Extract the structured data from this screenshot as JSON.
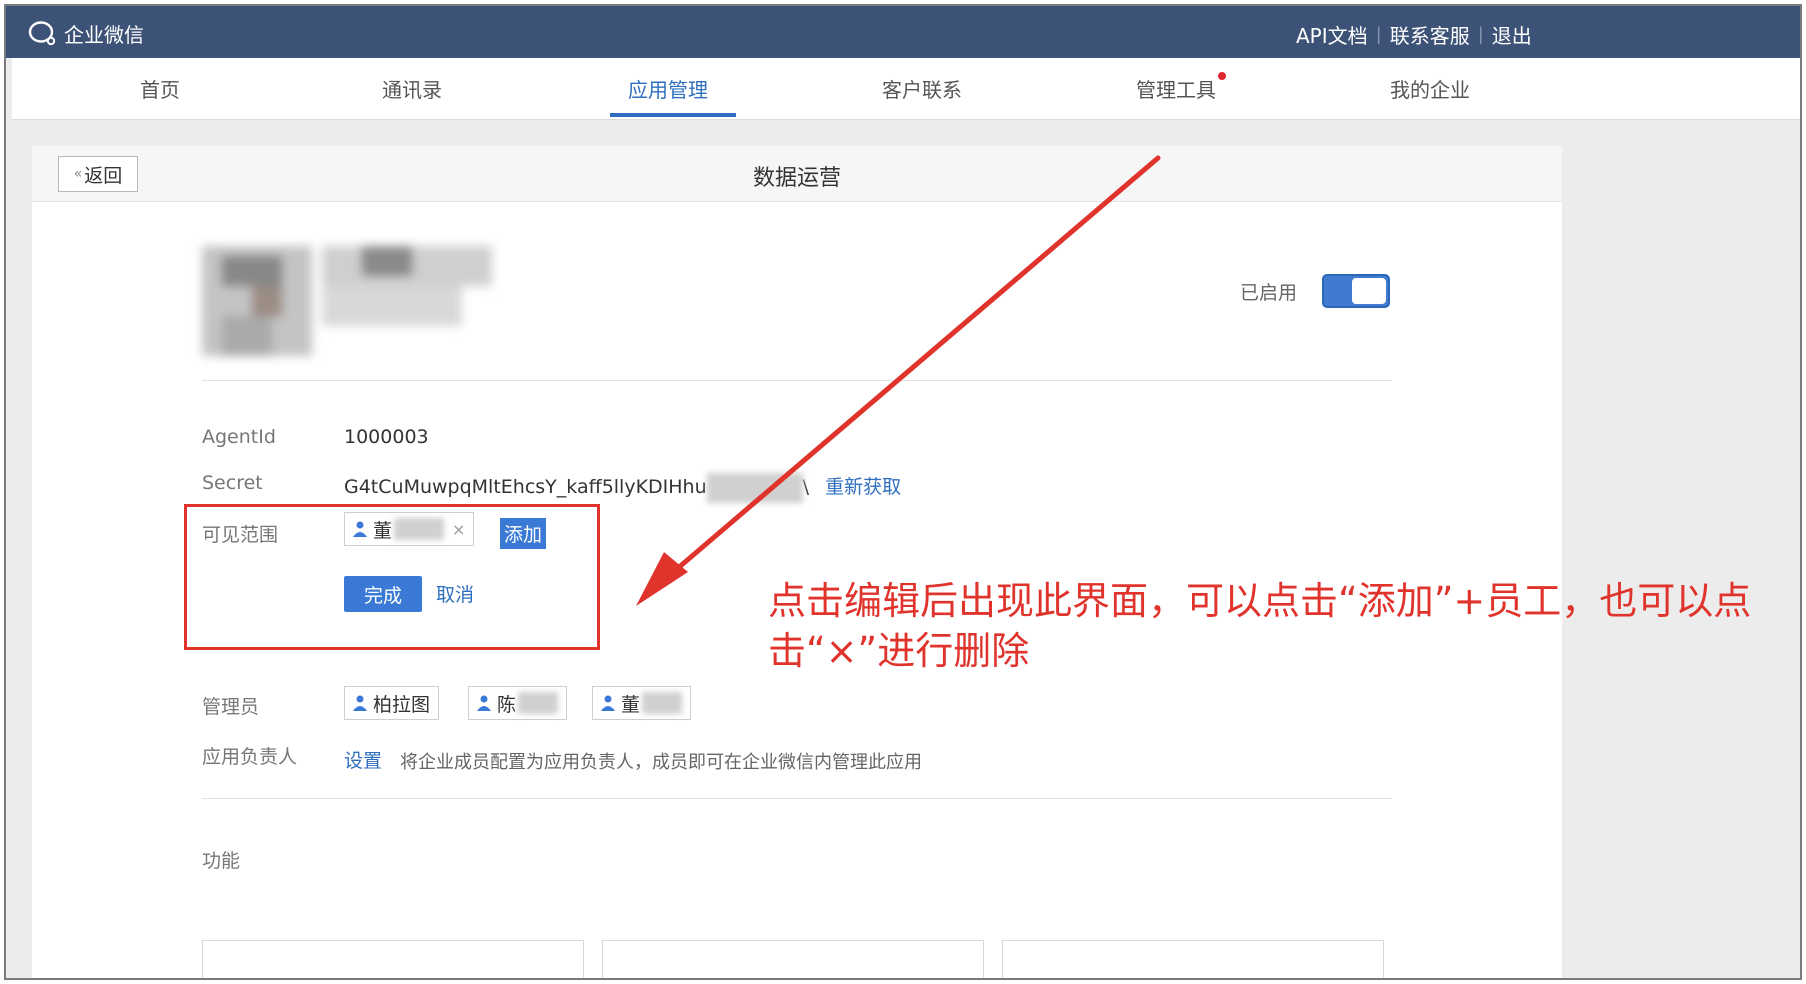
{
  "header": {
    "app_name": "企业微信",
    "links": [
      "API文档",
      "联系客服",
      "退出"
    ]
  },
  "nav": {
    "items": [
      "首页",
      "通讯录",
      "应用管理",
      "客户联系",
      "管理工具",
      "我的企业"
    ],
    "active": "应用管理"
  },
  "page": {
    "back_label": "返回",
    "title": "数据运营"
  },
  "app": {
    "enabled_label": "已启用",
    "enabled": true
  },
  "fields": {
    "agentid_label": "AgentId",
    "agentid_value": "1000003",
    "secret_label": "Secret",
    "secret_value": "G4tCuMuwpqMltEhcsY_kaff5llyKDIHhu",
    "secret_tail": "\\",
    "refresh_link": "重新获取",
    "visible_scope_label": "可见范围",
    "visible_member": "董",
    "add_link": "添加",
    "done_button": "完成",
    "cancel_link": "取消",
    "admins_label": "管理员",
    "admins": [
      "柏拉图",
      "陈",
      "董"
    ],
    "owner_label": "应用负责人",
    "owner_set_link": "设置",
    "owner_hint": "将企业成员配置为应用负责人，成员即可在企业微信内管理此应用",
    "functions_label": "功能"
  },
  "annotation": {
    "text_line1": "点击编辑后出现此界面，可以点击“添加”+员工，也可以点",
    "text_line2": "击“×”进行删除",
    "color": "#e0332c"
  },
  "colors": {
    "header_bg": "#3d5277",
    "accent": "#3a7ad6",
    "link": "#2e6fbf"
  }
}
